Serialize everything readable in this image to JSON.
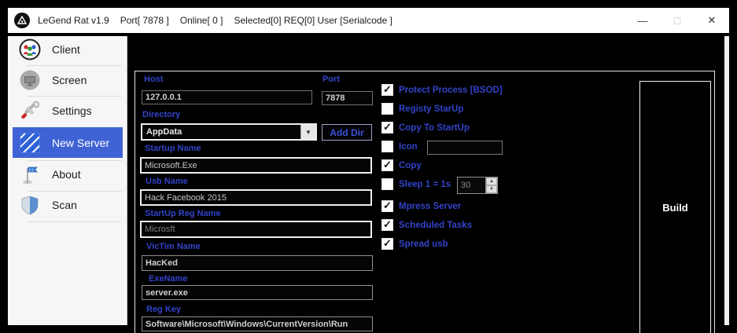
{
  "titlebar": {
    "app_title": "LeGend Rat v1.9",
    "port_info": "Port[ 7878 ]",
    "online_info": "Online[ 0 ]",
    "session_info": "Selected[0] REQ[0] User [Serialcode ]",
    "controls": {
      "minimize_glyph": "—",
      "maximize_glyph": "◻",
      "close_glyph": "✕"
    }
  },
  "sidebar": {
    "items": [
      {
        "label": "Client",
        "icon": "people-icon",
        "selected": false
      },
      {
        "label": "Screen",
        "icon": "monitor-icon",
        "selected": false
      },
      {
        "label": "Settings",
        "icon": "tools-icon",
        "selected": false
      },
      {
        "label": "New Server",
        "icon": "server-patch-icon",
        "selected": true
      },
      {
        "label": "About",
        "icon": "flag-icon",
        "selected": false
      },
      {
        "label": "Scan",
        "icon": "shield-icon",
        "selected": false
      }
    ]
  },
  "form": {
    "host": {
      "label": "Host",
      "value": "127.0.0.1"
    },
    "port": {
      "label": "Port",
      "value": "7878"
    },
    "directory": {
      "label": "Directory",
      "value": "AppData",
      "add_button": "Add Dir"
    },
    "startup_name": {
      "label": "Startup Name",
      "value": "Microsoft.Exe"
    },
    "usb_name": {
      "label": "Usb Name",
      "value": "Hack Facebook 2015"
    },
    "startup_reg_name": {
      "label": "StartUp Reg Name",
      "value": "Microsft"
    },
    "victim_name": {
      "label": "VicTim Name",
      "value": "HacKed"
    },
    "exe_name": {
      "label": "ExeName",
      "value": "server.exe"
    },
    "reg_key": {
      "label": "Reg Key",
      "value": "Software\\Microsoft\\Windows\\CurrentVersion\\Run"
    }
  },
  "options": {
    "items": [
      {
        "label": "Protect Process [BSOD]",
        "checked": true
      },
      {
        "label": "Registy StarUp",
        "checked": false
      },
      {
        "label": "Copy To StartUp",
        "checked": true
      },
      {
        "label": "Icon",
        "checked": false
      },
      {
        "label": "Copy",
        "checked": true
      },
      {
        "label": "Sleep 1 = 1s",
        "checked": false
      },
      {
        "label": "Mpress Server",
        "checked": true
      },
      {
        "label": "Scheduled Tasks",
        "checked": true
      },
      {
        "label": "Spread usb",
        "checked": true
      }
    ],
    "icon_path_value": "",
    "sleep_value": "30"
  },
  "build": {
    "label": "Build"
  },
  "icons": {
    "check": "✓",
    "dropdown_arrow": "▼",
    "spin_up": "▲",
    "spin_down": "▼"
  },
  "colors": {
    "accent_label_blue": "#3243c8",
    "sidebar_selected_blue": "#3f63d4",
    "background": "#000000",
    "titlebar": "#ffffff"
  }
}
